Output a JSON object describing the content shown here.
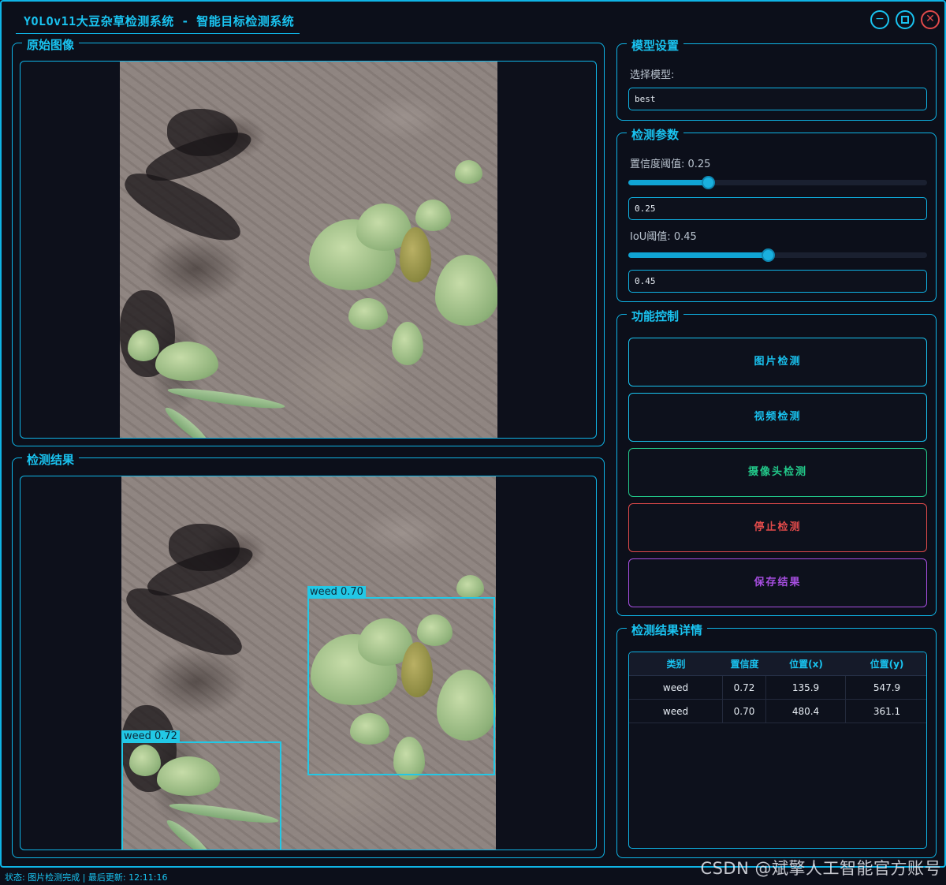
{
  "window": {
    "title": "YOLOv11大豆杂草检测系统 - 智能目标检测系统",
    "minimize_icon": "minus-icon",
    "maximize_icon": "square-icon",
    "close_icon": "x-circle-icon"
  },
  "original_panel": {
    "title": "原始图像"
  },
  "result_panel": {
    "title": "检测结果",
    "detections": [
      {
        "label": "weed 0.70"
      },
      {
        "label": "weed 0.72"
      }
    ]
  },
  "model_settings": {
    "title": "模型设置",
    "select_label": "选择模型:",
    "selected_model": "best"
  },
  "params": {
    "title": "检测参数",
    "conf_label": "置信度阈值: 0.25",
    "conf_value": "0.25",
    "conf_level": 0.25,
    "iou_label": "IoU阈值: 0.45",
    "iou_value": "0.45",
    "iou_level": 0.45
  },
  "controls": {
    "title": "功能控制",
    "image_detect": "图片检测",
    "video_detect": "视频检测",
    "camera_detect": "摄像头检测",
    "stop_detect": "停止检测",
    "save_result": "保存结果",
    "colors": {
      "image": "#19c3f0",
      "video": "#19c3f0",
      "camera": "#22c98a",
      "stop": "#e04a4a",
      "save": "#a64ee0"
    }
  },
  "details": {
    "title": "检测结果详情",
    "columns": [
      "类别",
      "置信度",
      "位置(x)",
      "位置(y)"
    ],
    "rows": [
      [
        "weed",
        "0.72",
        "135.9",
        "547.9"
      ],
      [
        "weed",
        "0.70",
        "480.4",
        "361.1"
      ]
    ]
  },
  "status": {
    "text": "状态: 图片检测完成 | 最后更新: 12:11:16"
  },
  "watermark": "CSDN @斌擎人工智能官方账号"
}
